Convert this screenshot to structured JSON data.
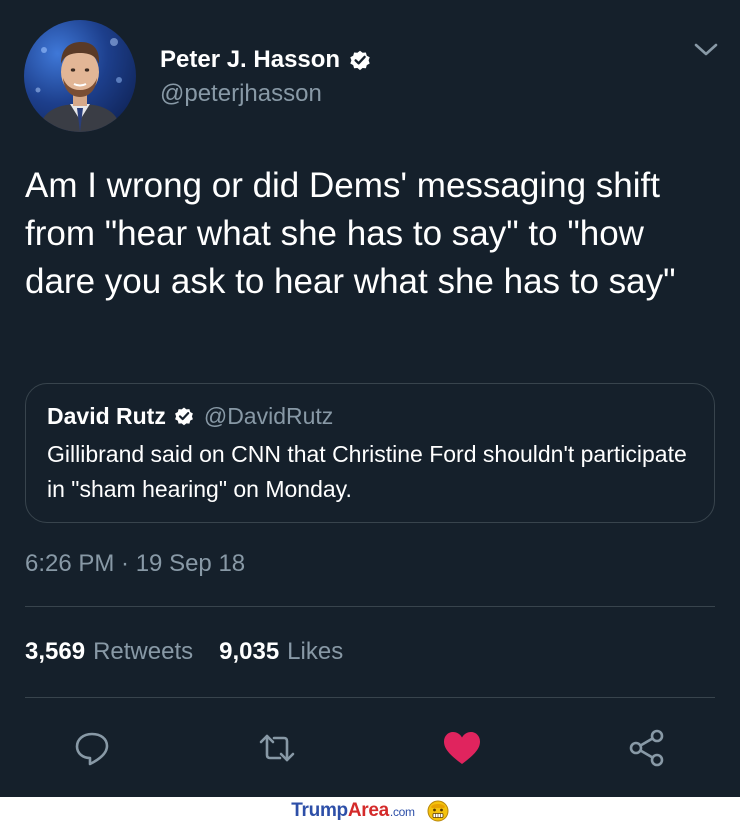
{
  "author": {
    "name": "Peter J. Hasson",
    "handle": "@peterjhasson",
    "verified": true,
    "avatar_icon": "profile-photo"
  },
  "tweet": {
    "text": "Am I wrong or did Dems' messaging shift from \"hear what she has to say\" to \"how dare you ask to hear what she has to say\"",
    "timestamp": "6:26 PM · 19 Sep 18"
  },
  "quoted_tweet": {
    "name": "David Rutz",
    "handle": "@DavidRutz",
    "verified": true,
    "text": "Gillibrand said on CNN that Christine Ford shouldn't participate in \"sham hearing\" on Monday."
  },
  "stats": {
    "retweets_count": "3,569",
    "retweets_label": "Retweets",
    "likes_count": "9,035",
    "likes_label": "Likes"
  },
  "actions": [
    "reply-icon",
    "retweet-icon",
    "heart-icon",
    "share-icon"
  ],
  "colors": {
    "background": "#15202b",
    "secondary_text": "#8899a6",
    "border": "#38444d",
    "like": "#e0245e",
    "verified_badge": "#ffffff"
  },
  "watermark": {
    "part1": "Trump",
    "part2": "Area",
    "part3": ".com"
  }
}
